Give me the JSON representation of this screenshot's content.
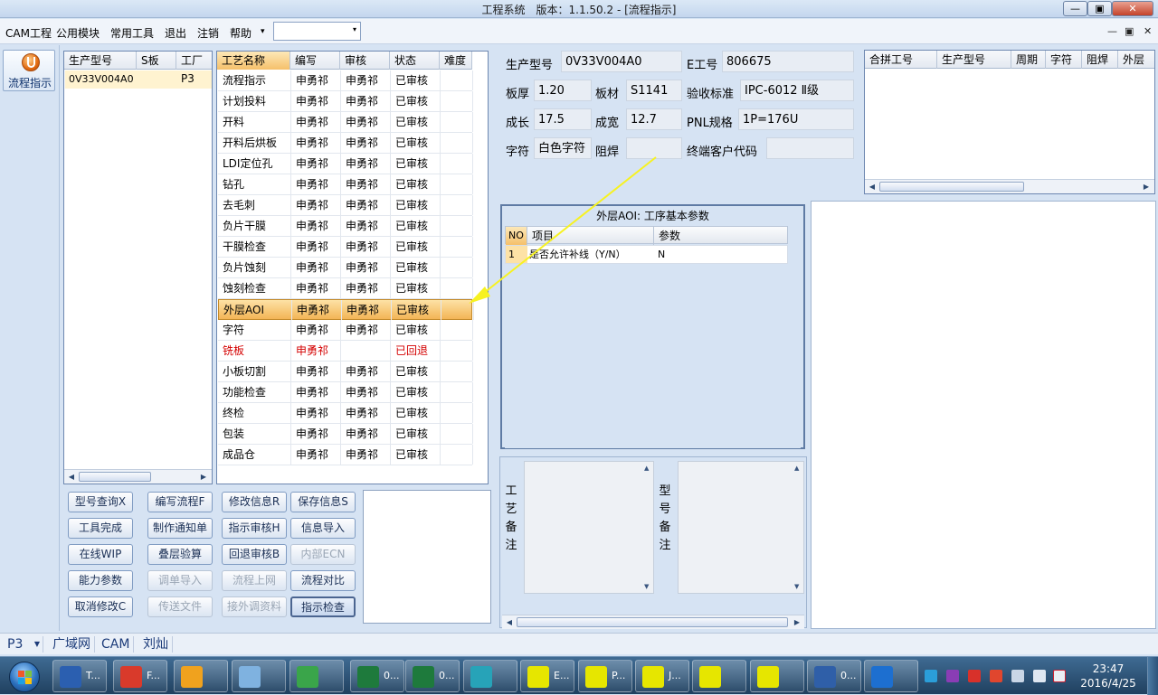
{
  "window": {
    "title": "工程系统　版本：1.1.50.2 - [流程指示]",
    "min_glyph": "—",
    "max_glyph": "▣",
    "close_glyph": "✕"
  },
  "menu": {
    "items": [
      "CAM工程",
      "公用模块",
      "常用工具",
      "退出",
      "注销",
      "帮助"
    ],
    "help_arrow": "▾",
    "combo_value": "",
    "combo_arrow": "▾",
    "mdi": [
      "—",
      "▣",
      "✕"
    ]
  },
  "leftbar": {
    "flow_button": "流程指示"
  },
  "model_table": {
    "columns": [
      "生产型号",
      "S板",
      "工厂"
    ],
    "rows": [
      {
        "model": "0V33V004A0",
        "s": "",
        "factory": "P3"
      }
    ]
  },
  "process_table": {
    "columns": [
      "工艺名称",
      "编写",
      "审核",
      "状态",
      "难度"
    ],
    "rows": [
      {
        "name": "流程指示",
        "writer": "申勇祁",
        "reviewer": "申勇祁",
        "status": "已审核"
      },
      {
        "name": "计划投料",
        "writer": "申勇祁",
        "reviewer": "申勇祁",
        "status": "已审核"
      },
      {
        "name": "开料",
        "writer": "申勇祁",
        "reviewer": "申勇祁",
        "status": "已审核"
      },
      {
        "name": "开料后烘板",
        "writer": "申勇祁",
        "reviewer": "申勇祁",
        "status": "已审核"
      },
      {
        "name": "LDI定位孔",
        "writer": "申勇祁",
        "reviewer": "申勇祁",
        "status": "已审核"
      },
      {
        "name": "钻孔",
        "writer": "申勇祁",
        "reviewer": "申勇祁",
        "status": "已审核"
      },
      {
        "name": "去毛刺",
        "writer": "申勇祁",
        "reviewer": "申勇祁",
        "status": "已审核"
      },
      {
        "name": "负片干膜",
        "writer": "申勇祁",
        "reviewer": "申勇祁",
        "status": "已审核"
      },
      {
        "name": "干膜检查",
        "writer": "申勇祁",
        "reviewer": "申勇祁",
        "status": "已审核"
      },
      {
        "name": "负片蚀刻",
        "writer": "申勇祁",
        "reviewer": "申勇祁",
        "status": "已审核"
      },
      {
        "name": "蚀刻检查",
        "writer": "申勇祁",
        "reviewer": "申勇祁",
        "status": "已审核"
      },
      {
        "name": "外层AOI",
        "writer": "申勇祁",
        "reviewer": "申勇祁",
        "status": "已审核"
      },
      {
        "name": "字符",
        "writer": "申勇祁",
        "reviewer": "申勇祁",
        "status": "已审核"
      },
      {
        "name": "铣板",
        "writer": "申勇祁",
        "reviewer": "",
        "status": "已回退"
      },
      {
        "name": "小板切割",
        "writer": "申勇祁",
        "reviewer": "申勇祁",
        "status": "已审核"
      },
      {
        "name": "功能检查",
        "writer": "申勇祁",
        "reviewer": "申勇祁",
        "status": "已审核"
      },
      {
        "name": "终检",
        "writer": "申勇祁",
        "reviewer": "申勇祁",
        "status": "已审核"
      },
      {
        "name": "包装",
        "writer": "申勇祁",
        "reviewer": "申勇祁",
        "status": "已审核"
      },
      {
        "name": "成品仓",
        "writer": "申勇祁",
        "reviewer": "申勇祁",
        "status": "已审核"
      }
    ],
    "selected_index": 11,
    "rejected_color": "#d40000"
  },
  "action_buttons": [
    [
      "型号查询X",
      "编写流程F",
      "修改信息R",
      "保存信息S"
    ],
    [
      "工具完成",
      "制作通知单",
      "指示审核H",
      "信息导入"
    ],
    [
      "在线WIP",
      "叠层验算",
      "回退审核B",
      "内部ECN"
    ],
    [
      "能力参数",
      "调单导入",
      "流程上网",
      "流程对比"
    ],
    [
      "取消修改C",
      "传送文件",
      "接外调资料",
      "指示检查"
    ]
  ],
  "info": {
    "model_label": "生产型号",
    "model_value": "0V33V004A0",
    "eno_label": "E工号",
    "eno_value": "806675",
    "thick_label": "板厚",
    "thick_value": "1.20",
    "material_label": "板材",
    "material_value": "S1141",
    "standard_label": "验收标准",
    "standard_value": "IPC-6012 Ⅱ级",
    "length_label": "成长",
    "length_value": "17.5",
    "width_label": "成宽",
    "width_value": "12.7",
    "pnl_label": "PNL规格",
    "pnl_value": "1P=176U",
    "char_label": "字符",
    "char_value": "白色字符",
    "mask_label": "阻焊",
    "mask_value": "",
    "customer_label": "终端客户代码",
    "customer_value": ""
  },
  "combine_table": {
    "columns": [
      "合拼工号",
      "生产型号",
      "周期",
      "字符",
      "阻焊",
      "外层"
    ]
  },
  "aoi": {
    "title": "外层AOI: 工序基本参数",
    "columns": [
      "NO",
      "项目",
      "参数"
    ],
    "rows": [
      {
        "no": "1",
        "item": "是否允许补线（Y/N）",
        "param": "N"
      }
    ]
  },
  "remarks": {
    "process_label": "工艺备注",
    "model_label": "型号备注"
  },
  "statusbar": {
    "factory": "P3",
    "items": [
      "广域网",
      "CAM",
      "刘灿"
    ]
  },
  "taskbar": {
    "buttons": [
      {
        "label": "T...",
        "icon": "floppy-icon",
        "color": "#2b5fb0"
      },
      {
        "label": "F...",
        "icon": "app-f-icon",
        "color": "#d93a2b"
      },
      {
        "label": "",
        "icon": "shell-icon",
        "color": "#f0a21e"
      },
      {
        "label": "",
        "icon": "notepad-icon",
        "color": "#7fb2e0"
      },
      {
        "label": "",
        "icon": "p-app-icon",
        "color": "#3aa54a"
      },
      {
        "label": "0...",
        "icon": "excel-icon",
        "color": "#1e7a3c"
      },
      {
        "label": "0...",
        "icon": "excel-icon",
        "color": "#1e7a3c"
      },
      {
        "label": "",
        "icon": "eye-app-icon",
        "color": "#27a3b8"
      },
      {
        "label": "E...",
        "icon": "xwindow-icon",
        "color": "#e6e600"
      },
      {
        "label": "P...",
        "icon": "xwindow-icon",
        "color": "#e6e600"
      },
      {
        "label": "J...",
        "icon": "xwindow-icon",
        "color": "#e6e600"
      },
      {
        "label": "",
        "icon": "xwindow-icon",
        "color": "#e6e600"
      },
      {
        "label": "",
        "icon": "xwindow-icon",
        "color": "#e6e600"
      },
      {
        "label": "0...",
        "icon": "word-icon",
        "color": "#2f5fa8"
      },
      {
        "label": "",
        "icon": "f-app-icon",
        "color": "#1d6fd0"
      }
    ],
    "time": "23:47",
    "date": "2016/4/25"
  }
}
